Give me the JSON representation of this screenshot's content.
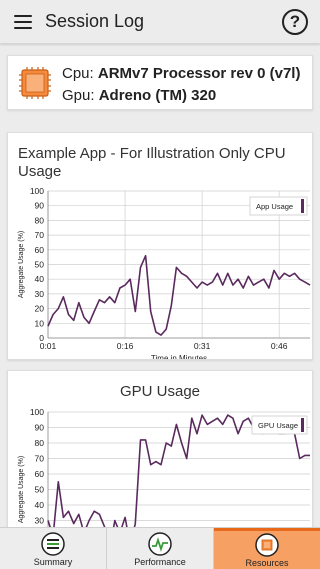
{
  "appbar": {
    "title": "Session Log",
    "menu_icon": "hamburger-menu-icon",
    "help_label": "?"
  },
  "device": {
    "cpu_label": "Cpu:",
    "cpu_value": "ARMv7 Processor rev 0 (v7l)",
    "gpu_label": "Gpu:",
    "gpu_value": "Adreno (TM) 320",
    "icon": "chip-icon"
  },
  "chart_data": [
    {
      "type": "line",
      "title": "Example App - For Illustration Only CPU Usage",
      "xlabel": "Time in Minutes",
      "ylabel": "Aggregate Usage (%)",
      "ylim": [
        0,
        100
      ],
      "yticks": [
        "0",
        "10",
        "20",
        "30",
        "40",
        "50",
        "60",
        "70",
        "80",
        "90",
        "100"
      ],
      "xticks": [
        "0:01",
        "0:16",
        "0:31",
        "0:46"
      ],
      "xtick_values": [
        1,
        16,
        31,
        46
      ],
      "xlim": [
        1,
        52
      ],
      "grid": true,
      "legend_position": "top-right",
      "series": [
        {
          "name": "App Usage",
          "color": "#5a2a5e",
          "x": [
            1,
            2,
            3,
            4,
            5,
            6,
            7,
            8,
            9,
            10,
            11,
            12,
            13,
            14,
            15,
            16,
            17,
            18,
            19,
            20,
            21,
            22,
            23,
            24,
            25,
            26,
            27,
            28,
            29,
            30,
            31,
            32,
            33,
            34,
            35,
            36,
            37,
            38,
            39,
            40,
            41,
            42,
            43,
            44,
            45,
            46,
            47,
            48,
            49,
            50,
            51,
            52
          ],
          "values": [
            8,
            16,
            20,
            28,
            16,
            12,
            24,
            14,
            10,
            18,
            26,
            24,
            28,
            24,
            34,
            36,
            40,
            18,
            48,
            56,
            18,
            4,
            2,
            6,
            22,
            48,
            44,
            42,
            38,
            34,
            38,
            36,
            38,
            44,
            36,
            44,
            36,
            40,
            34,
            42,
            36,
            38,
            40,
            34,
            46,
            40,
            44,
            42,
            44,
            40,
            38,
            36
          ]
        }
      ]
    },
    {
      "type": "line",
      "title": "GPU Usage",
      "xlabel": "",
      "ylabel": "Aggregate Usage (%)",
      "ylim": [
        0,
        100
      ],
      "yticks": [
        "0",
        "10",
        "20",
        "30",
        "40",
        "50",
        "60",
        "70",
        "80",
        "90",
        "100"
      ],
      "xlim": [
        1,
        52
      ],
      "grid": true,
      "legend_position": "top-right",
      "series": [
        {
          "name": "GPU Usage",
          "color": "#5a2a5e",
          "x": [
            1,
            2,
            3,
            4,
            5,
            6,
            7,
            8,
            9,
            10,
            11,
            12,
            13,
            14,
            15,
            16,
            17,
            18,
            19,
            20,
            21,
            22,
            23,
            24,
            25,
            26,
            27,
            28,
            29,
            30,
            31,
            32,
            33,
            34,
            35,
            36,
            37,
            38,
            39,
            40,
            41,
            42,
            43,
            44,
            45,
            46,
            47,
            48,
            49,
            50,
            51,
            52
          ],
          "values": [
            30,
            20,
            55,
            32,
            36,
            28,
            34,
            22,
            30,
            36,
            34,
            26,
            10,
            30,
            22,
            32,
            14,
            28,
            82,
            82,
            66,
            68,
            66,
            80,
            78,
            92,
            80,
            70,
            96,
            86,
            98,
            92,
            94,
            96,
            92,
            98,
            96,
            86,
            94,
            96,
            90,
            92,
            86,
            88,
            96,
            86,
            86,
            94,
            86,
            70,
            72,
            72
          ]
        }
      ]
    }
  ],
  "bottom_nav": {
    "tabs": [
      {
        "label": "Summary",
        "icon": "summary-list-icon",
        "active": false
      },
      {
        "label": "Performance",
        "icon": "performance-pulse-icon",
        "active": false
      },
      {
        "label": "Resources",
        "icon": "resources-chip-icon",
        "active": true
      }
    ]
  },
  "colors": {
    "accent": "#e8691a",
    "active_tab_bg": "#f6a064",
    "line": "#5a2a5e",
    "grid": "#cfcfcf",
    "card_bg": "#ffffff",
    "page_bg": "#ececec"
  }
}
